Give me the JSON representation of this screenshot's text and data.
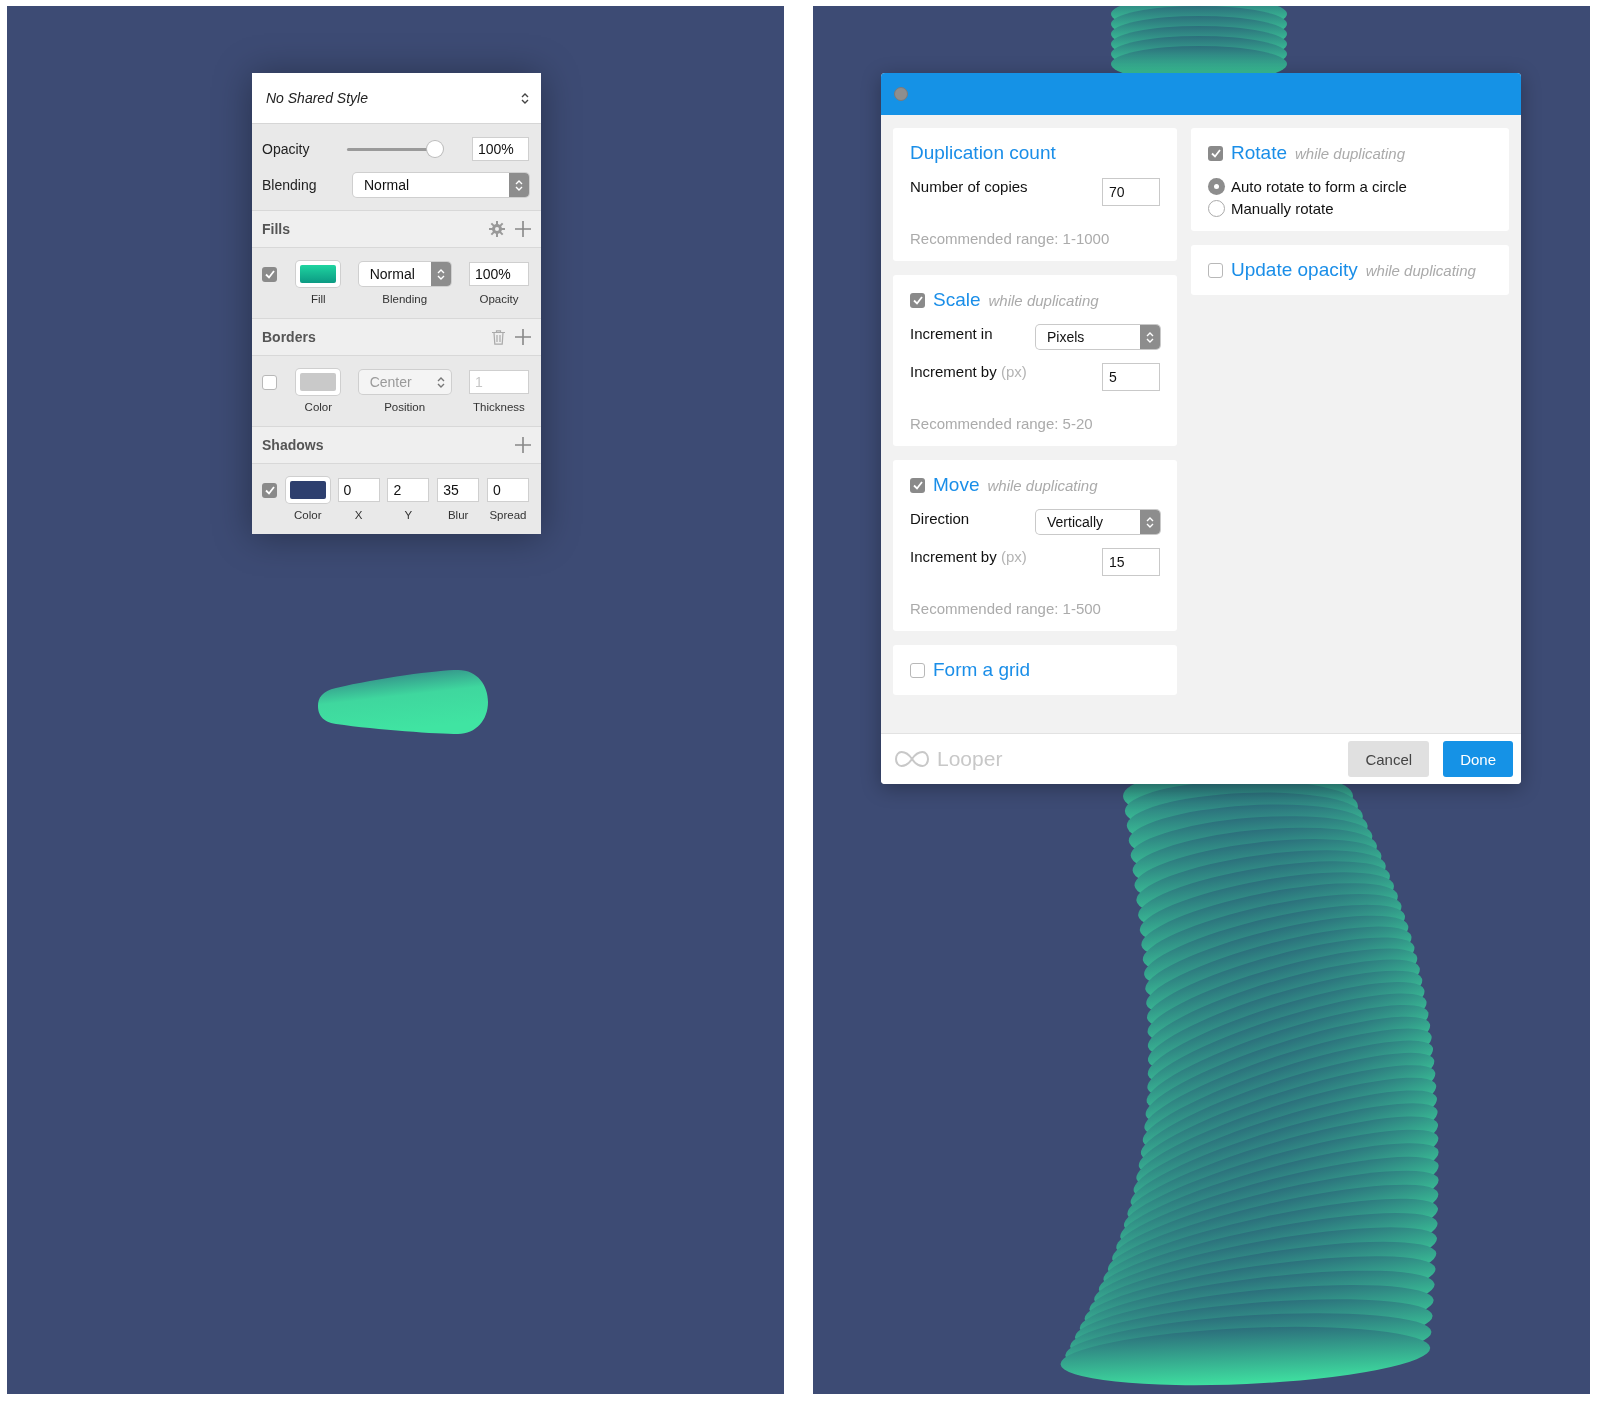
{
  "inspector": {
    "shared_style": "No Shared Style",
    "opacity": {
      "label": "Opacity",
      "level": 1,
      "value": "100%"
    },
    "blending": {
      "label": "Blending",
      "value": "Normal"
    },
    "fills": {
      "title": "Fills",
      "checked": true,
      "blending": "Normal",
      "opacity": "100%",
      "captions": [
        "Fill",
        "Blending",
        "Opacity"
      ]
    },
    "borders": {
      "title": "Borders",
      "checked": false,
      "position": "Center",
      "thickness_placeholder": "1",
      "captions": [
        "Color",
        "Position",
        "Thickness"
      ]
    },
    "shadows": {
      "title": "Shadows",
      "checked": true,
      "values": [
        "0",
        "2",
        "35",
        "0"
      ],
      "captions": [
        "Color",
        "X",
        "Y",
        "Blur",
        "Spread"
      ]
    }
  },
  "dialog": {
    "left": [
      {
        "title": "Duplication count",
        "fields": [
          {
            "kind": "input",
            "label": "Number of copies",
            "value": "70"
          }
        ],
        "hint": "Recommended range: 1-1000"
      },
      {
        "title": "Scale",
        "suffix": "while duplicating",
        "checked": true,
        "fields": [
          {
            "kind": "select",
            "label": "Increment in",
            "value": "Pixels"
          },
          {
            "kind": "input",
            "label": "Increment by",
            "unit": "(px)",
            "value": "5"
          }
        ],
        "hint": "Recommended range: 5-20"
      },
      {
        "title": "Move",
        "suffix": "while duplicating",
        "checked": true,
        "fields": [
          {
            "kind": "select",
            "label": "Direction",
            "value": "Vertically"
          },
          {
            "kind": "input",
            "label": "Increment by",
            "unit": "(px)",
            "value": "15"
          }
        ],
        "hint": "Recommended range: 1-500"
      },
      {
        "title": "Form a grid",
        "checked": false
      }
    ],
    "right": [
      {
        "title": "Rotate",
        "suffix": "while duplicating",
        "checked": true,
        "options": [
          {
            "label": "Auto rotate to form a circle",
            "selected": true
          },
          {
            "label": "Manually rotate",
            "selected": false
          }
        ]
      },
      {
        "title": "Update opacity",
        "suffix": "while duplicating",
        "checked": false
      }
    ],
    "footer": {
      "brand": "Looper",
      "buttons": [
        {
          "label": "Cancel",
          "kind": "secondary"
        },
        {
          "label": "Done",
          "kind": "primary"
        }
      ]
    }
  }
}
